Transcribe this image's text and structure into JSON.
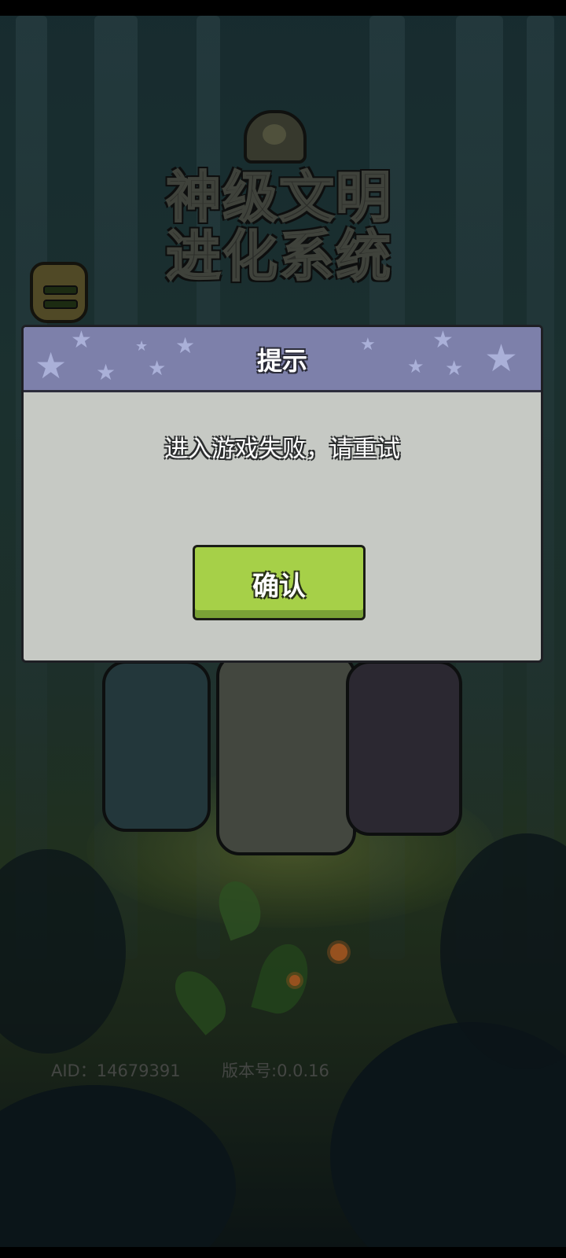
{
  "game": {
    "logo_line1": "神级文明",
    "logo_line2": "进化系统"
  },
  "dialog": {
    "title": "提示",
    "message": "进入游戏失败，请重试",
    "confirm_label": "确认"
  },
  "footer": {
    "aid": "AID：14679391",
    "version": "版本号:0.0.16"
  },
  "colors": {
    "dialog_header": "#7d80aa",
    "dialog_body": "#c6c9c4",
    "confirm_button": "#a6d048"
  },
  "icons": [
    "menu-icon",
    "star-icon",
    "mascot-icon"
  ]
}
